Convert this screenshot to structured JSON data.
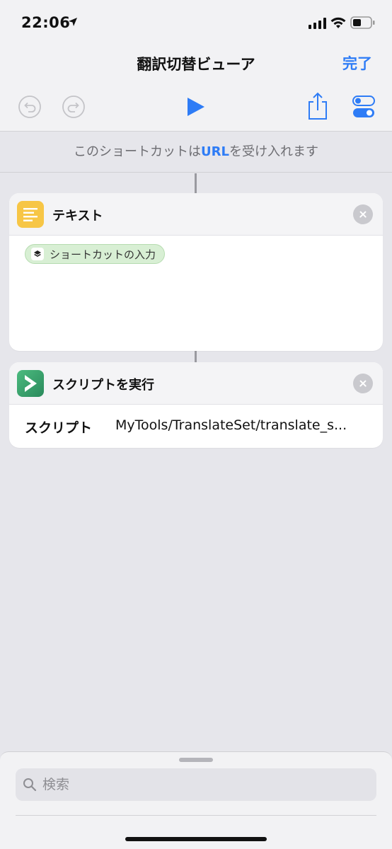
{
  "status": {
    "time": "22:06"
  },
  "nav": {
    "title": "翻訳切替ビューア",
    "done_label": "完了"
  },
  "accepts": {
    "prefix": "このショートカットは",
    "type": "URL",
    "suffix": "を受け入れます"
  },
  "actions": [
    {
      "title": "テキスト",
      "icon": "text-lines-icon",
      "color": "#f7c646",
      "token": "ショートカットの入力"
    },
    {
      "title": "スクリプトを実行",
      "icon": "chevron-right-icon",
      "color": "#3aa56a",
      "param_label": "スクリプト",
      "param_value": "MyTools/TranslateSet/translate_s..."
    }
  ],
  "search": {
    "placeholder": "検索",
    "value": ""
  },
  "colors": {
    "accent": "#2e7cf6"
  }
}
